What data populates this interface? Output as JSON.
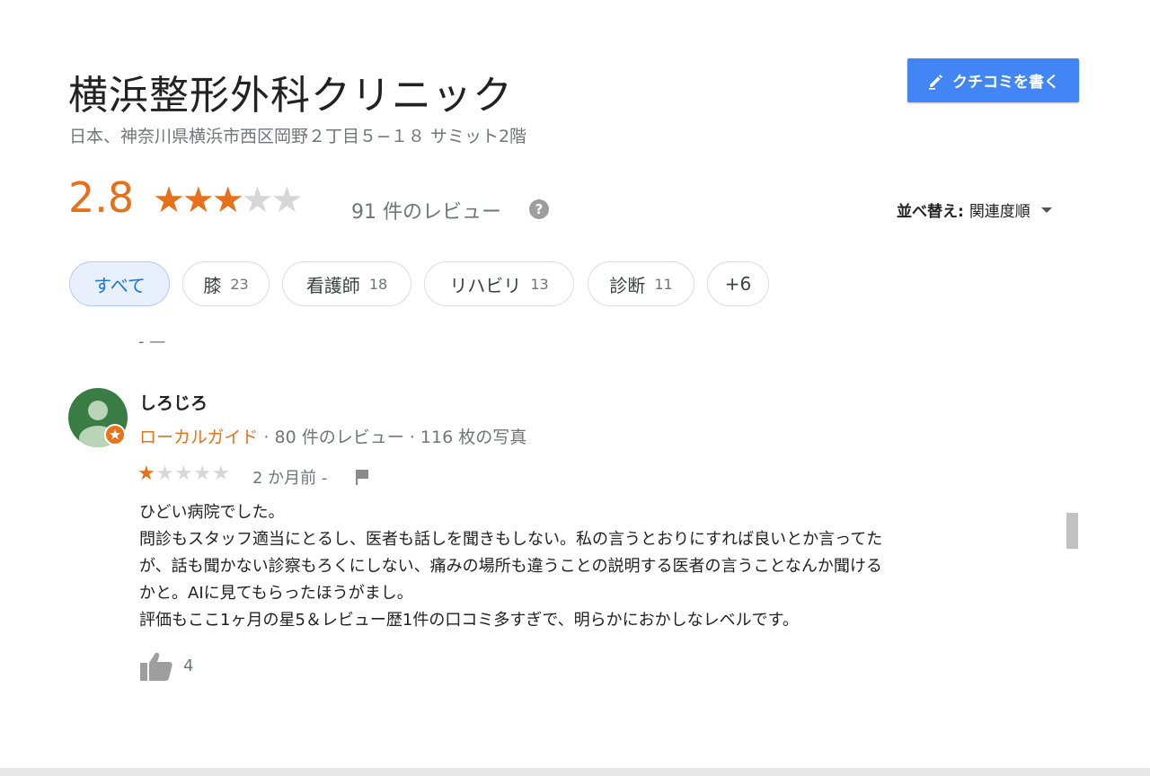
{
  "place": {
    "name": "横浜整形外科クリニック",
    "address": "日本、神奈川県横浜市西区岡野２丁目５−１８ サミット2階"
  },
  "write_review": {
    "label": "クチコミを書く",
    "icon": "pencil-icon"
  },
  "summary": {
    "rating": "2.8",
    "rating_value": 2.8,
    "stars_filled": 3,
    "stars_total": 5,
    "review_count_text": "91 件のレビュー",
    "help_icon": "?"
  },
  "sort": {
    "label": "並べ替え:",
    "value": "関連度順"
  },
  "filters": [
    {
      "label": "すべて",
      "count": ""
    },
    {
      "label": "膝",
      "count": "23"
    },
    {
      "label": "看護師",
      "count": "18"
    },
    {
      "label": "リハビリ",
      "count": "13"
    },
    {
      "label": "診断",
      "count": "11"
    },
    {
      "label": "+6",
      "count": ""
    }
  ],
  "separator": "- —",
  "review": {
    "author": "しろじろ",
    "local_guide": "ローカルガイド",
    "stats": " · 80 件のレビュー · 116 枚の写真",
    "stars_filled": 1,
    "stars_total": 5,
    "posted": "2 か月前 -",
    "lines": [
      "ひどい病院でした。",
      "問診もスタッフ適当にとるし、医者も話しを聞きもしない。私の言うとおりにすれば良いとか言ってた",
      "が、話も聞かない診察もろくにしない、痛みの場所も違うことの説明する医者の言うことなんか聞ける",
      "かと。AIに見てもらったほうがまし。",
      "評価もここ1ヶ月の星5＆レビュー歴1件の口コミ多すぎで、明らかにおかしなレベルです。"
    ],
    "likes": "4"
  },
  "colors": {
    "accent_orange": "#e7711b",
    "button_blue": "#4285f4",
    "chip_active_bg": "#e8f0fe",
    "chip_active_text": "#1a73e8"
  }
}
